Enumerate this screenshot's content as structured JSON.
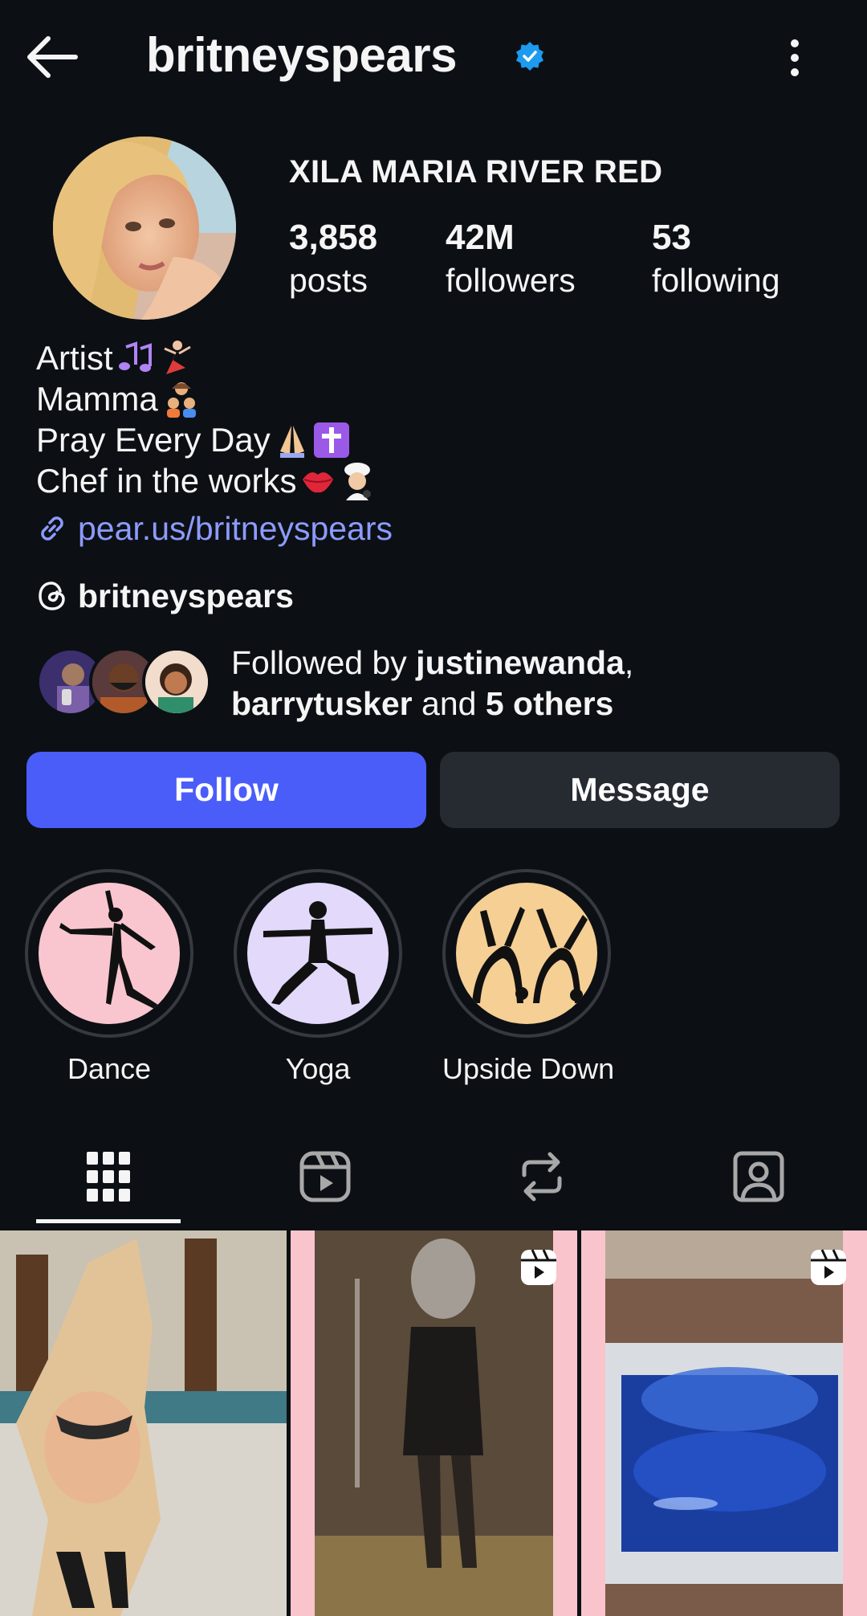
{
  "header": {
    "handle": "britneyspears",
    "back_icon": "arrow-left-icon",
    "verified_icon": "verified-badge-icon",
    "more_icon": "more-vertical-icon"
  },
  "profile": {
    "display_name": "XILA MARIA RIVER RED",
    "stats": [
      {
        "value": "3,858",
        "label": "posts"
      },
      {
        "value": "42M",
        "label": "followers"
      },
      {
        "value": "53",
        "label": "following"
      }
    ]
  },
  "bio": {
    "lines": [
      "Artist",
      "Mamma",
      "Pray Every Day",
      "Chef in the works"
    ],
    "link": "pear.us/britneyspears"
  },
  "threads": {
    "handle": "britneyspears"
  },
  "mutuals": {
    "prefix": "Followed by ",
    "user1": "justinewanda",
    "sep": ",",
    "user2": "barrytusker",
    "middle": " and ",
    "others": "5 others"
  },
  "actions": {
    "follow": "Follow",
    "message": "Message"
  },
  "highlights": [
    {
      "label": "Dance",
      "bg": "#f9c6cf"
    },
    {
      "label": "Yoga",
      "bg": "#e2d9fb"
    },
    {
      "label": "Upside Down",
      "bg": "#f5cf94"
    }
  ],
  "tabs": [
    "grid-icon",
    "reels-icon",
    "reposts-icon",
    "tagged-icon"
  ],
  "colors": {
    "background": "#0c1014",
    "follow_button": "#4a5df9",
    "message_button": "#262a31",
    "link": "#8c9bff",
    "verified": "#1d9bf0"
  }
}
